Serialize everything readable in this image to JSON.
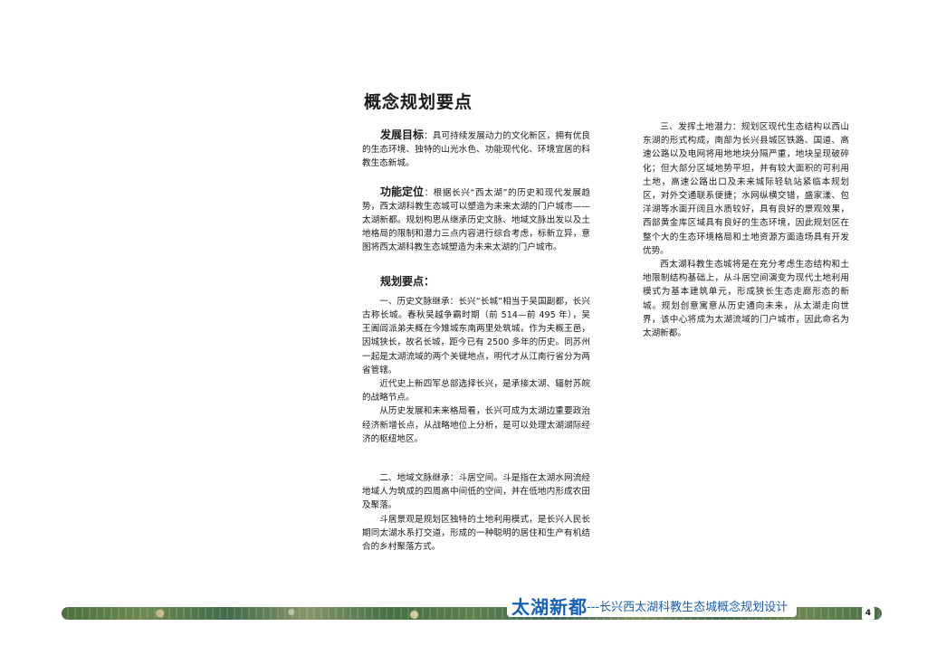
{
  "page": {
    "title": "概念规划要点",
    "page_number": "4"
  },
  "left_column": {
    "goal_label": "发展目标",
    "goal_text": "：具可持续发展动力的文化新区，拥有优良的生态环境、独特的山光水色、功能现代化、环境宜居的科教生态新城。",
    "function_label": "功能定位",
    "function_text": "：根据长兴“西太湖”的历史和现代发展趋势，西太湖科教生态城可以塑造为未来太湖的门户城市——太湖新都。规划构思从继承历史文脉、地域文脉出发以及土地格局的限制和潜力三点内容进行综合考虑，标新立异，意图将西太湖科教生态城塑造为未来太湖的门户城市。",
    "points_heading": "规划要点",
    "points_colon": "：",
    "history_p1": "一、历史文脉继承：长兴“长城”相当于吴国副都，长兴古称长城。春秋吴越争霸时期（前 514—前 495 年），吴王阖闾派弟夫概在今雉城东南两里处筑城，作为夫概王邑，因城狭长，故名长城，距今已有 2500 多年的历史。同苏州一起是太湖流域的两个关键地点，明代才从江南行省分为两省管辖。",
    "history_p2": "近代史上新四军总部选择长兴，是承接太湖、辐射苏皖的战略节点。",
    "history_p3": "从历史发展和未来格局看，长兴可成为太湖边重要政治经济新增长点，从战略地位上分析，是可以处理太湖湖际经济的枢纽地区。",
    "region_p1": "二、地域文脉继承：斗居空间。斗是指在太湖水网流经地域人为筑成的四周高中间低的空间，并在低地内形成农田及聚落。",
    "region_p2": "斗居景观是规划区独特的土地利用模式，是长兴人民长期同太湖水系打交道，形成的一种聪明的居住和生产有机结合的乡村聚落方式。"
  },
  "right_column": {
    "land_p1": "三、发挥土地潜力：规划区现代生态结构以西山东湖的形式构成，南部为长兴县城区铁路、国道、高速公路以及电网将用地地块分隔严重，地块呈现破碎化；但大部分区域地势平坦，并有较大面积的可利用土地，高速公路出口及未来城际轻轨站紧临本规划区，对外交通联系便捷；水网纵横交错，盛家漾、包洋湖等水面开阔且水质较好，具有良好的景观效果，西部黄金库区域具有良好的生态环境，因此规划区在整个大的生态环境格局和土地资源方面造场具有开发优势。",
    "land_p2": "西太湖科教生态城将是在充分考虑生态结构和土地限制结构基础上，从斗居空间演变为现代土地利用模式为基本建筑单元，形成狭长生态走廊形态的新城。规划创意寓意从历史通向未来，从太湖走向世界，该中心将成为太湖流域的门户城市，因此命名为　　太湖新都。"
  },
  "footer": {
    "brand": "太湖新都",
    "subtitle": "---长兴西太湖科教生态城概念规划设计"
  }
}
